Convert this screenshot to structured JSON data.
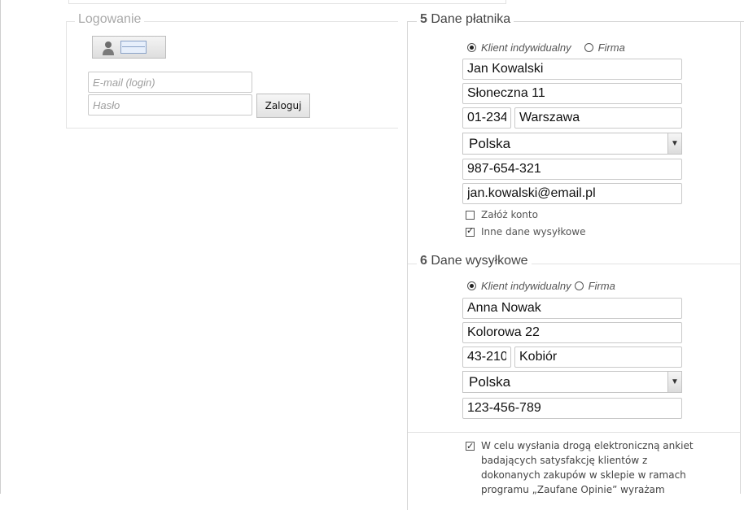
{
  "login": {
    "legend": "Logowanie",
    "email_placeholder": "E-mail (login)",
    "password_placeholder": "Hasło",
    "login_button": "Zaloguj"
  },
  "payer": {
    "number": "5",
    "title": "Dane płatnika",
    "type_individual": "Klient indywidualny",
    "type_company": "Firma",
    "selected_type": "individual",
    "name": "Jan Kowalski",
    "street": "Słoneczna 11",
    "postcode": "01-234",
    "city": "Warszawa",
    "country": "Polska",
    "phone": "987-654-321",
    "email": "jan.kowalski@email.pl",
    "create_account_label": "Załóż konto",
    "create_account_checked": false,
    "other_shipping_label": "Inne dane wysyłkowe",
    "other_shipping_checked": true
  },
  "shipping": {
    "number": "6",
    "title": "Dane wysyłkowe",
    "type_individual": "Klient indywidualny",
    "type_company": "Firma",
    "selected_type": "individual",
    "name": "Anna Nowak",
    "street": "Kolorowa 22",
    "postcode": "43-210",
    "city": "Kobiór",
    "country": "Polska",
    "phone": "123-456-789"
  },
  "consent": {
    "checked": true,
    "text": "W celu wysłania drogą elektroniczną ankiet badających satysfakcję klientów z dokonanych zakupów w sklepie w ramach programu „Zaufane Opinie” wyrażam"
  },
  "icons": {
    "person": "person-icon",
    "id_card": "id-card-icon",
    "select_arrow": "chevron-down-icon"
  }
}
